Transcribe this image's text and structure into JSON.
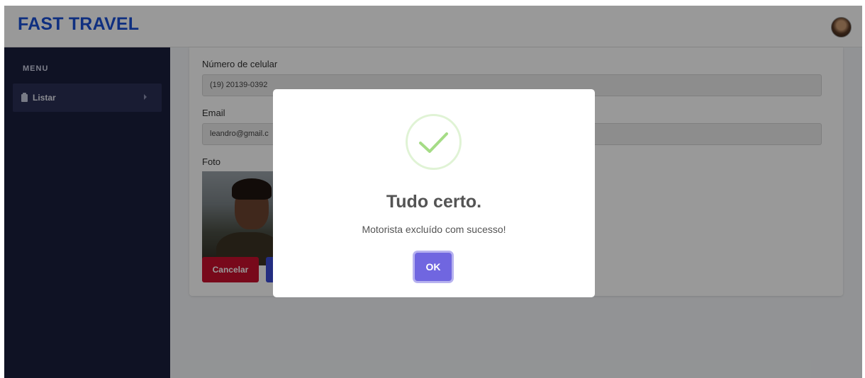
{
  "header": {
    "brand": "FAST TRAVEL",
    "avatar_icon": "user-avatar"
  },
  "sidebar": {
    "menu_title": "MENU",
    "items": [
      {
        "label": "Listar",
        "icon": "clipboard-icon"
      }
    ]
  },
  "form": {
    "phone_label": "Número de celular",
    "phone_value": "(19) 20139-0392",
    "email_label": "Email",
    "email_value": "leandro@gmail.c",
    "photo_label": "Foto",
    "cancel_label": "Cancelar"
  },
  "modal": {
    "title": "Tudo certo.",
    "message": "Motorista excluído com sucesso!",
    "ok_label": "OK",
    "icon": "success-check-icon"
  },
  "colors": {
    "brand": "#1a4fd6",
    "sidebar": "#1a1e3c",
    "cancel": "#c8102e",
    "confirm": "#7066e0",
    "success": "#a5dc86"
  }
}
